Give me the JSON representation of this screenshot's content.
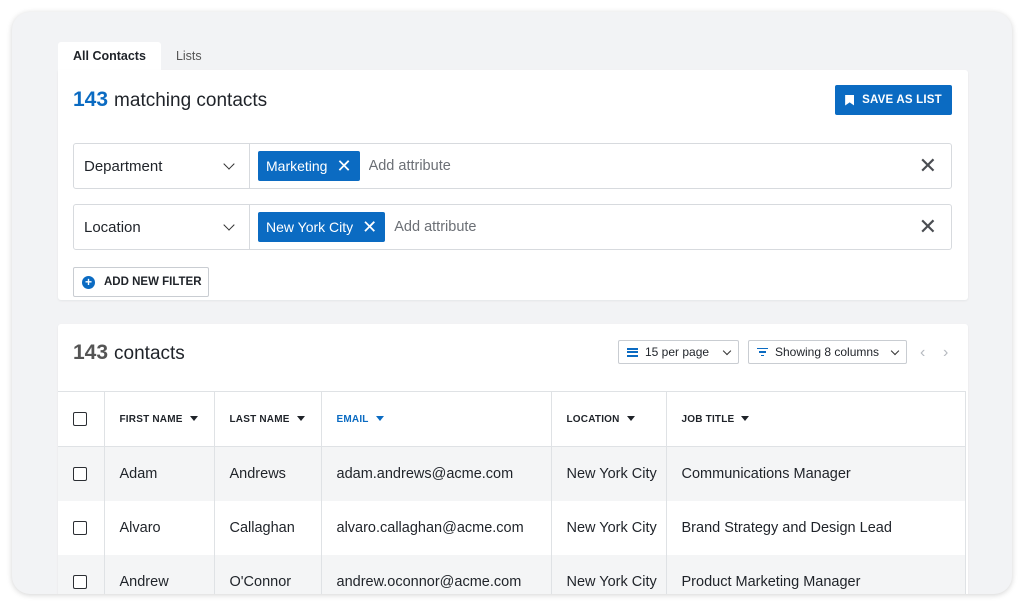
{
  "tabs": [
    {
      "label": "All Contacts",
      "active": true
    },
    {
      "label": "Lists",
      "active": false
    }
  ],
  "filter_panel": {
    "match_count": "143",
    "match_label": "matching contacts",
    "save_button": "SAVE AS LIST",
    "filters": [
      {
        "field": "Department",
        "chip": "Marketing",
        "placeholder": "Add attribute"
      },
      {
        "field": "Location",
        "chip": "New York City",
        "placeholder": "Add attribute"
      }
    ],
    "add_filter_button": "ADD NEW FILTER"
  },
  "results": {
    "count": "143",
    "count_label": "contacts",
    "per_page": "15 per page",
    "columns": "Showing 8 columns",
    "headers": [
      "FIRST NAME",
      "LAST NAME",
      "EMAIL",
      "LOCATION",
      "JOB TITLE"
    ],
    "sorted_column": "EMAIL",
    "rows": [
      {
        "first": "Adam",
        "last": "Andrews",
        "email": "adam.andrews@acme.com",
        "location": "New York City",
        "title": "Communications Manager"
      },
      {
        "first": "Alvaro",
        "last": "Callaghan",
        "email": "alvaro.callaghan@acme.com",
        "location": "New York City",
        "title": "Brand Strategy and Design Lead"
      },
      {
        "first": "Andrew",
        "last": "O'Connor",
        "email": "andrew.oconnor@acme.com",
        "location": "New York City",
        "title": "Product Marketing Manager"
      }
    ]
  },
  "colors": {
    "accent": "#0b6bc2",
    "background": "#f2f3f5"
  },
  "icons": [
    "bookmark-icon",
    "chevron-down-icon",
    "close-icon",
    "plus-circle-icon",
    "list-icon",
    "filter-icon",
    "chevron-left-icon",
    "chevron-right-icon",
    "sort-down-icon",
    "checkbox-icon"
  ]
}
